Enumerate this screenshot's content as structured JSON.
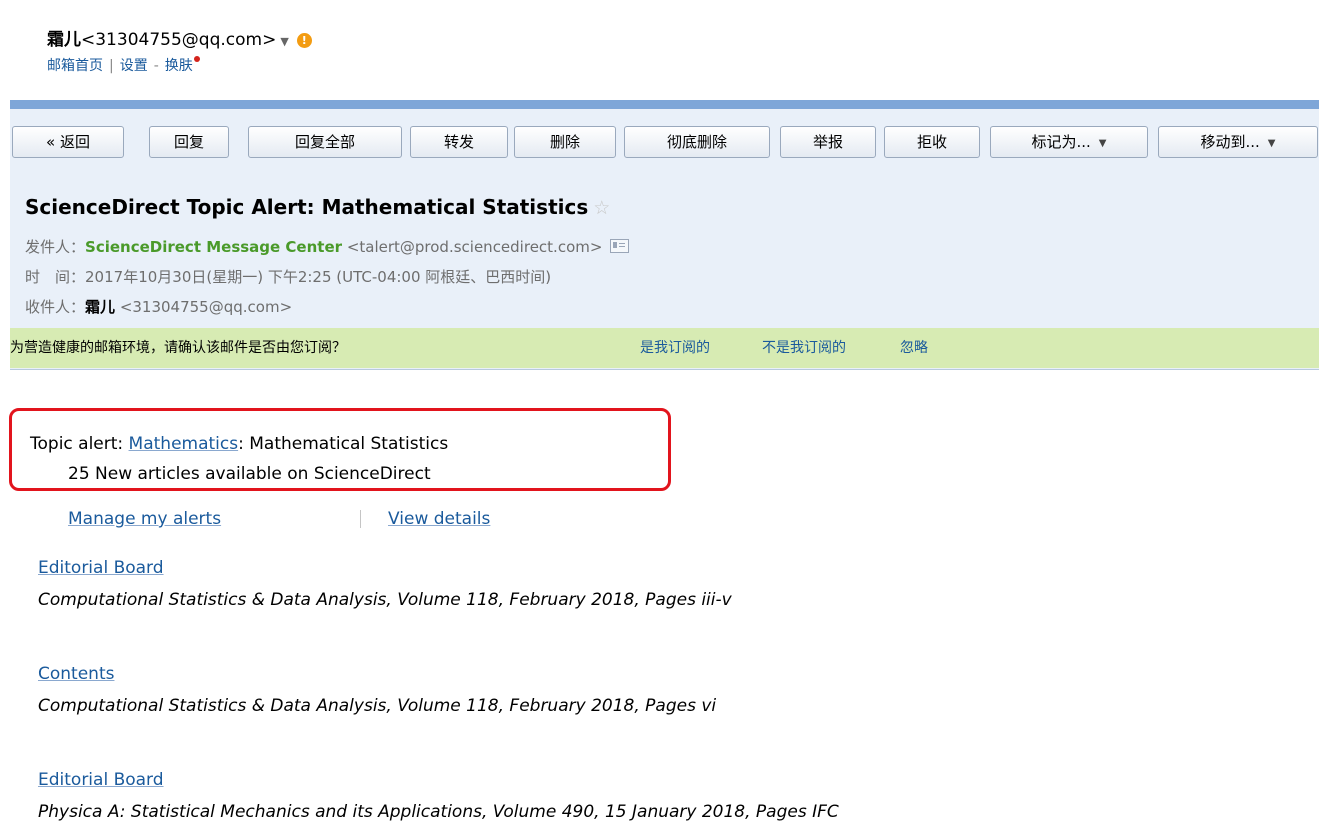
{
  "header": {
    "user_name": "霜儿",
    "user_email": "<31304755@qq.com>",
    "dropdown_glyph": "▼",
    "alert_glyph": "!",
    "nav": [
      "邮箱首页",
      "设置",
      "换肤"
    ],
    "nav_separators": [
      "|",
      "-"
    ]
  },
  "toolbar": {
    "back": "« 返回",
    "reply": "回复",
    "reply_all": "回复全部",
    "forward": "转发",
    "delete": "删除",
    "delete_permanently": "彻底删除",
    "report": "举报",
    "reject": "拒收",
    "mark_as": "标记为...",
    "move_to": "移动到...",
    "caret": "▼"
  },
  "mail": {
    "subject": "ScienceDirect Topic Alert: Mathematical Statistics",
    "star": "☆",
    "from_label": "发件人：",
    "from_name": "ScienceDirect Message Center",
    "from_email": "<talert@prod.sciencedirect.com>",
    "time_label": "时　间：",
    "time_value": "2017年10月30日(星期一) 下午2:25 (UTC-04:00 阿根廷、巴西时间)",
    "to_label": "收件人：",
    "to_name": "霜儿",
    "to_email": "<31304755@qq.com>"
  },
  "confirm_bar": {
    "question": "为营造健康的邮箱环境，请确认该邮件是否由您订阅？",
    "yes": "是我订阅的",
    "no": "不是我订阅的",
    "ignore": "忽略"
  },
  "body": {
    "topic_prefix": "Topic alert: ",
    "topic_link": "Mathematics",
    "topic_suffix": ": Mathematical Statistics",
    "new_articles": "25 New articles available on ScienceDirect",
    "manage_alerts": "Manage my alerts",
    "view_details": "View details",
    "articles": [
      {
        "title": "Editorial Board",
        "source": "Computational Statistics & Data Analysis, Volume 118, February 2018, Pages iii-v"
      },
      {
        "title": "Contents",
        "source": "Computational Statistics & Data Analysis, Volume 118, February 2018, Pages vi"
      },
      {
        "title": "Editorial Board",
        "source": "Physica A: Statistical Mechanics and its Applications, Volume 490, 15 January 2018, Pages IFC"
      }
    ]
  },
  "colors": {
    "link": "#1a5a9c",
    "sender_green": "#4a9a2a",
    "confirm_bar_bg": "#d7ebb3",
    "panel_bg": "#e9f0f9",
    "highlight_red": "#e2141d"
  }
}
